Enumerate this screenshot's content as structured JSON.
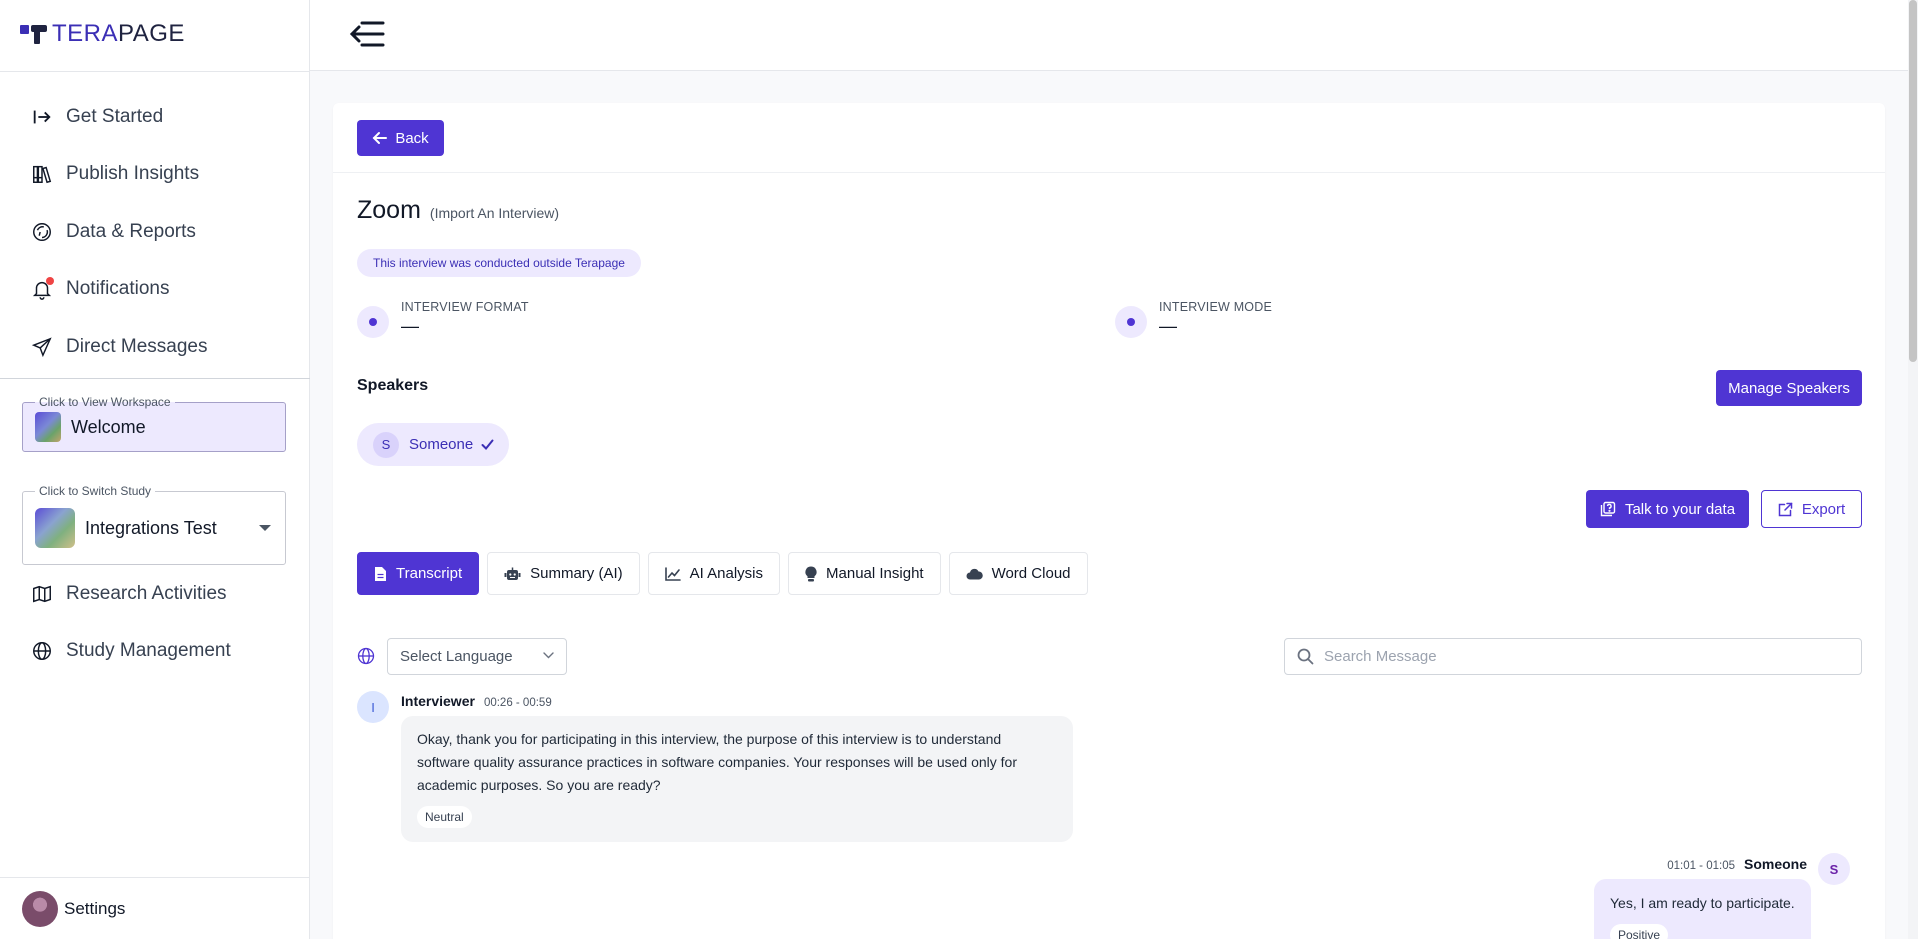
{
  "brand": {
    "tera": "TERA",
    "page": "PAGE"
  },
  "nav_top": [
    {
      "label": "Get Started",
      "icon": "sign-in-icon"
    },
    {
      "label": "Publish Insights",
      "icon": "books-icon"
    },
    {
      "label": "Data & Reports",
      "icon": "chart-circle-icon"
    },
    {
      "label": "Notifications",
      "icon": "bell-icon"
    },
    {
      "label": "Direct Messages",
      "icon": "paper-plane-icon"
    }
  ],
  "workspace": {
    "legend": "Click to View Workspace",
    "name": "Welcome"
  },
  "study": {
    "legend": "Click to Switch Study",
    "name": "Integrations Test"
  },
  "nav_bottom": [
    {
      "label": "Research Activities",
      "icon": "map-icon"
    },
    {
      "label": "Study Management",
      "icon": "globe-icon"
    }
  ],
  "settings": {
    "label": "Settings"
  },
  "main": {
    "back_label": "Back",
    "title": "Zoom",
    "subtitle": "(Import An Interview)",
    "info_pill": "This interview was conducted outside Terapage",
    "meta": [
      {
        "label": "INTERVIEW FORMAT",
        "value": "—"
      },
      {
        "label": "INTERVIEW MODE",
        "value": "—"
      }
    ],
    "speakers_title": "Speakers",
    "manage_speakers": "Manage Speakers",
    "speakers": [
      {
        "initial": "S",
        "name": "Someone"
      }
    ],
    "talk_label": "Talk to your data",
    "export_label": "Export",
    "tabs": [
      {
        "label": "Transcript",
        "icon": "document-icon",
        "active": true
      },
      {
        "label": "Summary (AI)",
        "icon": "robot-icon",
        "active": false
      },
      {
        "label": "AI Analysis",
        "icon": "line-chart-icon",
        "active": false
      },
      {
        "label": "Manual Insight",
        "icon": "lightbulb-icon",
        "active": false
      },
      {
        "label": "Word Cloud",
        "icon": "cloud-icon",
        "active": false
      }
    ],
    "language_placeholder": "Select Language",
    "search_placeholder": "Search Message",
    "messages": [
      {
        "initial": "I",
        "speaker": "Interviewer",
        "time": "00:26 - 00:59",
        "text": "Okay, thank you for participating in this interview, the purpose of this interview is to understand software quality assurance practices in software companies. Your responses will be used only for academic purposes. So you are ready?",
        "sentiment": "Neutral"
      },
      {
        "initial": "S",
        "speaker": "Someone",
        "time": "01:01 - 01:05",
        "text": "Yes, I am ready to participate.",
        "sentiment": "Positive"
      }
    ]
  },
  "colors": {
    "accent": "#4f35d3",
    "accent_light": "#ede9fe",
    "notification": "#ef4444"
  }
}
